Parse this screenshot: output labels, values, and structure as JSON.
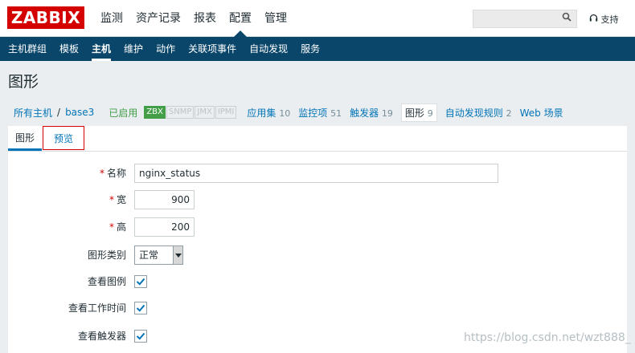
{
  "logo": "ZABBIX",
  "main_menu": [
    "监测",
    "资产记录",
    "报表",
    "配置",
    "管理"
  ],
  "support": "支持",
  "sub_menu": [
    "主机群组",
    "模板",
    "主机",
    "维护",
    "动作",
    "关联项事件",
    "自动发现",
    "服务"
  ],
  "page_title": "图形",
  "host_nav": {
    "all_hosts": "所有主机",
    "separator": "/",
    "host": "base3",
    "status": "已启用",
    "availability": [
      "ZBX",
      "SNMP",
      "JMX",
      "IPMI"
    ],
    "items": [
      {
        "label": "应用集",
        "count": "10"
      },
      {
        "label": "监控项",
        "count": "51"
      },
      {
        "label": "触发器",
        "count": "19"
      },
      {
        "label": "图形",
        "count": "9"
      },
      {
        "label": "自动发现规则",
        "count": "2"
      },
      {
        "label": "Web 场景",
        "count": ""
      }
    ]
  },
  "tabs": {
    "graph": "图形",
    "preview": "预览"
  },
  "form": {
    "name_label": "名称",
    "name_value": "nginx_status",
    "width_label": "宽",
    "width_value": "900",
    "height_label": "高",
    "height_value": "200",
    "type_label": "图形类别",
    "type_value": "正常",
    "show_legend_label": "查看图例",
    "show_worktime_label": "查看工作时间",
    "show_triggers_label": "查看触发器"
  },
  "watermark": "https://blog.csdn.net/wzt888_",
  "colors": {
    "brand": "#d40000",
    "nav": "#0a466a",
    "link": "#0275b8",
    "enabled": "#429e47"
  }
}
